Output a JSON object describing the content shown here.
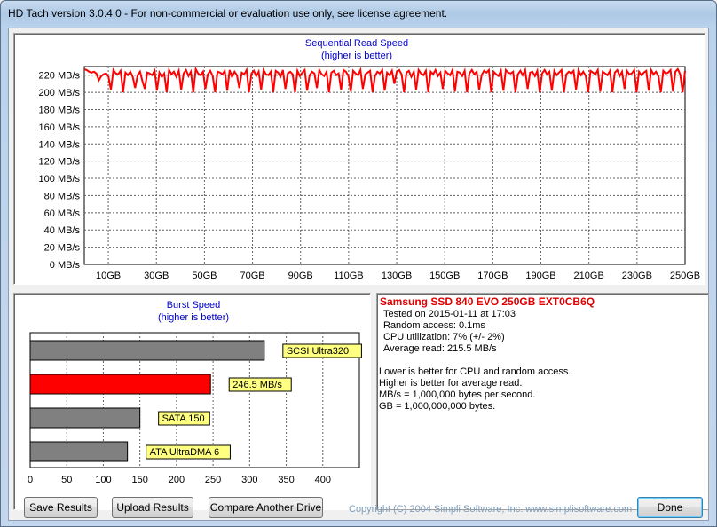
{
  "window": {
    "title": "HD Tach version 3.0.4.0  - For non-commercial or evaluation use only, see license agreement."
  },
  "sequential_chart": {
    "title": "Sequential Read Speed",
    "subtitle": "(higher is better)"
  },
  "burst_chart": {
    "title": "Burst Speed",
    "subtitle": "(higher is better)"
  },
  "chart_data": [
    {
      "type": "line",
      "title": "Sequential Read Speed",
      "subtitle": "(higher is better)",
      "xlabel": "",
      "ylabel": "",
      "xlim": [
        0,
        250
      ],
      "ylim": [
        0,
        230
      ],
      "x_unit": "GB",
      "y_unit": "MB/s",
      "x_tick_labels": [
        "10GB",
        "30GB",
        "50GB",
        "70GB",
        "90GB",
        "110GB",
        "130GB",
        "150GB",
        "170GB",
        "190GB",
        "210GB",
        "230GB",
        "250GB"
      ],
      "y_tick_labels": [
        "0 MB/s",
        "20 MB/s",
        "40 MB/s",
        "60 MB/s",
        "80 MB/s",
        "100 MB/s",
        "120 MB/s",
        "140 MB/s",
        "160 MB/s",
        "180 MB/s",
        "200 MB/s",
        "220 MB/s"
      ],
      "grid": true,
      "color": "#ff0000",
      "series": [
        {
          "values": [
            227,
            226,
            224,
            223,
            224,
            222,
            214,
            219,
            221,
            222,
            218,
            203,
            226,
            222,
            221,
            225,
            200,
            223,
            220,
            224,
            218,
            205,
            220,
            224,
            213,
            204,
            223,
            222,
            220,
            225,
            202,
            223,
            218,
            222,
            200,
            226,
            221,
            224,
            218,
            225,
            203,
            222,
            226,
            219,
            224,
            200,
            227,
            222,
            220,
            224,
            204,
            221,
            225,
            219,
            200,
            224,
            223,
            221,
            225,
            202,
            226,
            218,
            224,
            220,
            205,
            223,
            221,
            226,
            200,
            222,
            225,
            219,
            224,
            203,
            226,
            221,
            220,
            224,
            200,
            225,
            223,
            218,
            226,
            204,
            222,
            224,
            221,
            200,
            225,
            219,
            223,
            226,
            202,
            220,
            224,
            222,
            205,
            226,
            221,
            219,
            224,
            200,
            223,
            225,
            220,
            222,
            203,
            226,
            224,
            219,
            201,
            225,
            222,
            220,
            226,
            204,
            221,
            223,
            225,
            200,
            219,
            224,
            222,
            226,
            202,
            223,
            220,
            225,
            210,
            224,
            226,
            221,
            200,
            223,
            225,
            218,
            224,
            203,
            226,
            222,
            220,
            225,
            200,
            224,
            221,
            226,
            219,
            223,
            204,
            225,
            222,
            220,
            226,
            201,
            224,
            223,
            219,
            225,
            200,
            222,
            226,
            221,
            224,
            203,
            220,
            225,
            223,
            226,
            200,
            224,
            221,
            219,
            225,
            202,
            226,
            223,
            222,
            224,
            200,
            221,
            225,
            220,
            226,
            204,
            223,
            224,
            219,
            225,
            200,
            222,
            226,
            221,
            224,
            202,
            225,
            220,
            223,
            226,
            200,
            221,
            224,
            222,
            225,
            203,
            226,
            220,
            224,
            219,
            200,
            225,
            223,
            221,
            226,
            201,
            224,
            222,
            220,
            225,
            200,
            223,
            226,
            219,
            224,
            204,
            225,
            221,
            222,
            226,
            200,
            224,
            220,
            223,
            225,
            202,
            226,
            221,
            224,
            219,
            200,
            225,
            222,
            223,
            226,
            201,
            224,
            227,
            221,
            200,
            225
          ]
        }
      ]
    },
    {
      "type": "bar",
      "orientation": "horizontal",
      "title": "Burst Speed",
      "subtitle": "(higher is better)",
      "xlim": [
        0,
        450
      ],
      "x_tick_labels": [
        "0",
        "50",
        "100",
        "150",
        "200",
        "250",
        "300",
        "350",
        "400"
      ],
      "grid": true,
      "categories": [
        "SCSI Ultra320",
        "246.5 MB/s",
        "SATA 150",
        "ATA UltraDMA 6"
      ],
      "values": [
        320,
        246.5,
        150,
        133
      ],
      "colors": [
        "#808080",
        "#ff0000",
        "#808080",
        "#808080"
      ],
      "label_color": "#ffff80"
    }
  ],
  "info": {
    "drive_name": "Samsung SSD 840 EVO 250GB EXT0CB6Q",
    "lines": [
      "Tested on 2015-01-11 at 17:03",
      "Random access: 0.1ms",
      "CPU utilization: 7% (+/- 2%)",
      "Average read: 215.5 MB/s"
    ],
    "notes": [
      "Lower is better for CPU and random access.",
      "Higher is better for average read.",
      "MB/s = 1,000,000 bytes per second.",
      "GB = 1,000,000,000 bytes."
    ]
  },
  "buttons": {
    "save": "Save Results",
    "upload": "Upload Results",
    "compare": "Compare Another Drive",
    "done": "Done"
  },
  "copyright": "Copyright (C) 2004 Simpli Software, Inc. www.simplisoftware.com",
  "colors": {
    "accent_text": "#0000cc",
    "line": "#ff0000",
    "label_bg": "#ffff80"
  }
}
